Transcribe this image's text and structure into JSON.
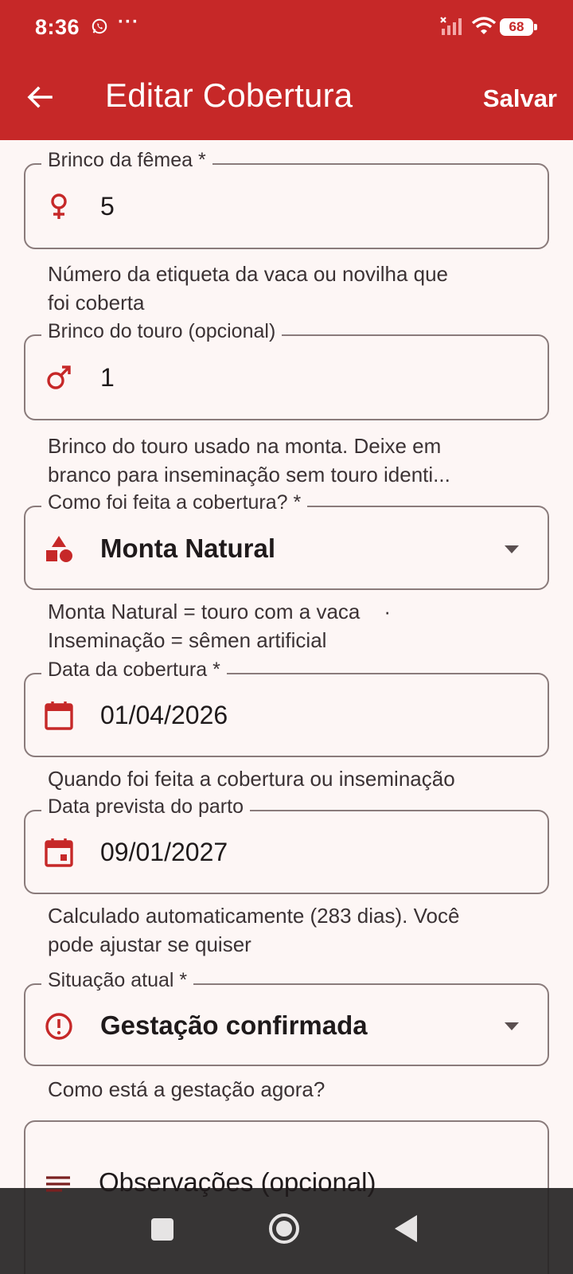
{
  "status_bar": {
    "time": "8:36",
    "dots": "···",
    "battery": "68",
    "icons": [
      "whatsapp-icon",
      "signal-icon",
      "wifi-icon",
      "battery-icon"
    ]
  },
  "app_bar": {
    "title": "Editar Cobertura",
    "save_label": "Salvar",
    "back_icon": "arrow-left-icon",
    "color": "#c62828"
  },
  "form": {
    "female_tag": {
      "label": "Brinco da fêmea *",
      "value": "5",
      "helper_line1": "Número da etiqueta da vaca ou novilha que",
      "helper_line2": "foi coberta",
      "icon": "female-icon"
    },
    "bull_tag": {
      "label": "Brinco do touro (opcional)",
      "value": "1",
      "helper_line1": "Brinco do touro usado na monta. Deixe em",
      "helper_line2": "branco para inseminação sem touro identi...",
      "icon": "male-icon"
    },
    "method": {
      "label": "Como foi feita a cobertura? *",
      "value": "Monta Natural",
      "helper_line1": "Monta Natural = touro com a vaca",
      "helper_dot": "·",
      "helper_line2": "Inseminação = sêmen artificial",
      "icon": "shapes-icon"
    },
    "breeding_date": {
      "label": "Data da cobertura *",
      "value": "01/04/2026",
      "helper_line1": "Quando foi feita a cobertura ou inseminação",
      "icon": "calendar-icon"
    },
    "due_date": {
      "label": "Data prevista do parto",
      "value": "09/01/2027",
      "helper_line1": "Calculado automaticamente (283 dias). Você",
      "helper_line2": "pode ajustar se quiser",
      "icon": "calendar-event-icon"
    },
    "status": {
      "label": "Situação atual *",
      "value": "Gestação confirmada",
      "helper_line1": "Como está a gestação agora?",
      "icon": "info-icon"
    },
    "notes": {
      "placeholder": "Observações (opcional)",
      "icon": "notes-icon"
    }
  },
  "nav_bar": {
    "buttons": [
      "recents-button",
      "home-button",
      "back-button"
    ]
  }
}
